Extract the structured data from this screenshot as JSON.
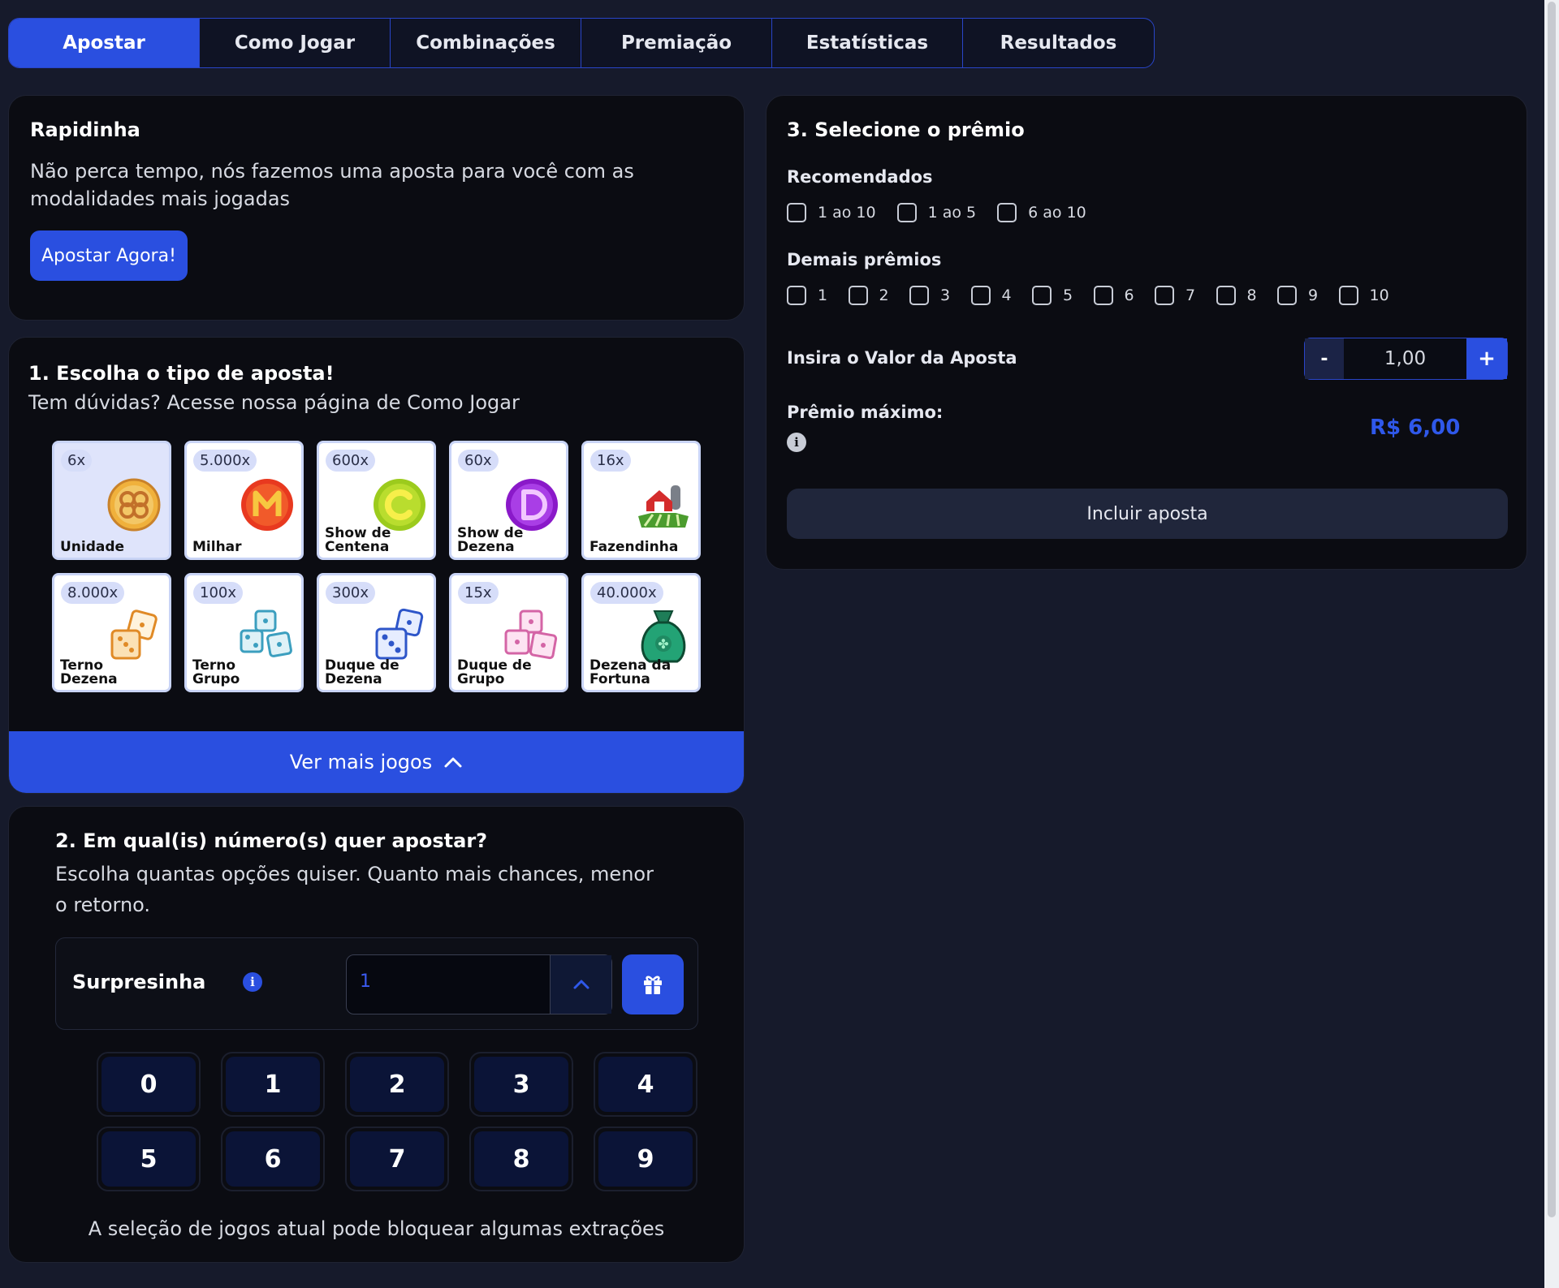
{
  "tabs": [
    "Apostar",
    "Como Jogar",
    "Combinações",
    "Premiação",
    "Estatísticas",
    "Resultados"
  ],
  "active_tab": "Apostar",
  "rapidinha": {
    "title": "Rapidinha",
    "text": "Não perca tempo, nós fazemos uma aposta para você com as modalidades mais jogadas",
    "button": "Apostar Agora!"
  },
  "bet_type": {
    "title": "1. Escolha o tipo de aposta!",
    "subtitle": "Tem dúvidas? Acesse nossa página de Como Jogar",
    "games": [
      {
        "mult": "6x",
        "name": "Unidade",
        "icon": "clover-coin-icon",
        "selected": true
      },
      {
        "mult": "5.000x",
        "name": "Milhar",
        "icon": "letter-m-coin-icon"
      },
      {
        "mult": "600x",
        "name": "Show de Centena",
        "icon": "letter-c-coin-icon"
      },
      {
        "mult": "60x",
        "name": "Show de Dezena",
        "icon": "letter-d-coin-icon"
      },
      {
        "mult": "16x",
        "name": "Fazendinha",
        "icon": "farm-icon"
      },
      {
        "mult": "8.000x",
        "name": "Terno Dezena",
        "icon": "orange-dice-icon"
      },
      {
        "mult": "100x",
        "name": "Terno Grupo",
        "icon": "teal-dice-icon"
      },
      {
        "mult": "300x",
        "name": "Duque de Dezena",
        "icon": "blue-dice-icon"
      },
      {
        "mult": "15x",
        "name": "Duque de Grupo",
        "icon": "pink-dice-icon"
      },
      {
        "mult": "40.000x",
        "name": "Dezena da Fortuna",
        "icon": "money-bag-icon"
      }
    ],
    "more_button": "Ver mais jogos"
  },
  "numbers": {
    "title": "2. Em qual(is) número(s) quer apostar?",
    "subtitle": "Escolha quantas opções quiser. Quanto mais chances, menor o retorno.",
    "surpresinha_label": "Surpresinha",
    "surpresinha_value": "1",
    "digits": [
      "0",
      "1",
      "2",
      "3",
      "4",
      "5",
      "6",
      "7",
      "8",
      "9"
    ],
    "warning": "A seleção de jogos atual pode bloquear algumas extrações"
  },
  "prize": {
    "title": "3. Selecione o prêmio",
    "recommended_label": "Recomendados",
    "recommended": [
      "1 ao 10",
      "1 ao 5",
      "6 ao 10"
    ],
    "other_label": "Demais prêmios",
    "other": [
      "1",
      "2",
      "3",
      "4",
      "5",
      "6",
      "7",
      "8",
      "9",
      "10"
    ],
    "value_label": "Insira o Valor da Aposta",
    "minus": "-",
    "plus": "+",
    "value": "1,00",
    "max_label": "Prêmio máximo:",
    "max_value": "R$ 6,00",
    "include_button": "Incluir aposta"
  },
  "colors": {
    "background": "#161a2b",
    "card": "#0b0c12",
    "accent": "#2a4fe0",
    "digit_bg": "#0b1437"
  }
}
